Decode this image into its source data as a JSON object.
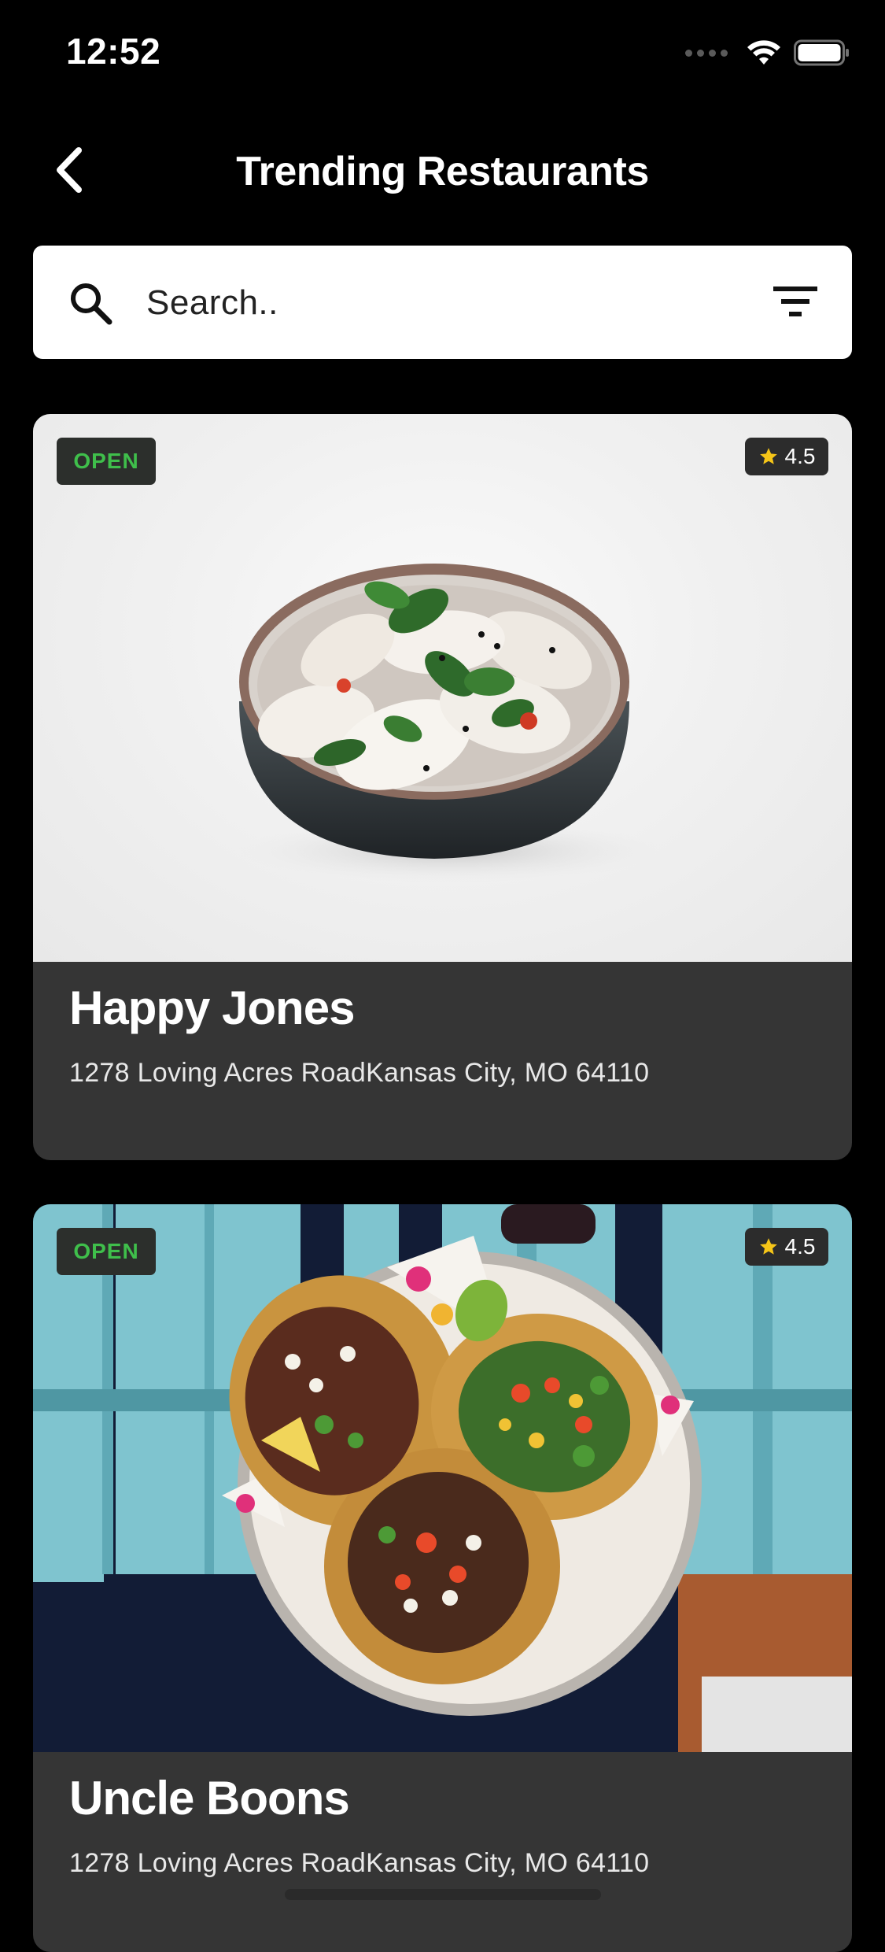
{
  "status_bar": {
    "time": "12:52"
  },
  "header": {
    "title": "Trending Restaurants",
    "back_icon": "chevron-left-icon"
  },
  "search": {
    "placeholder": "Search..",
    "value": "",
    "search_icon": "search-icon",
    "filter_icon": "filter-icon"
  },
  "restaurants": [
    {
      "name": "Happy Jones",
      "address": "1278 Loving Acres RoadKansas City, MO 64110",
      "status": "OPEN",
      "rating": "4.5",
      "image": "dumplings-bowl"
    },
    {
      "name": "Uncle Boons",
      "address": "1278 Loving Acres RoadKansas City, MO 64110",
      "status": "OPEN",
      "rating": "4.5",
      "image": "tacos-plate"
    }
  ],
  "colors": {
    "background": "#000000",
    "card": "#353535",
    "open_green": "#3fbf4b",
    "star_yellow": "#f5c518"
  }
}
